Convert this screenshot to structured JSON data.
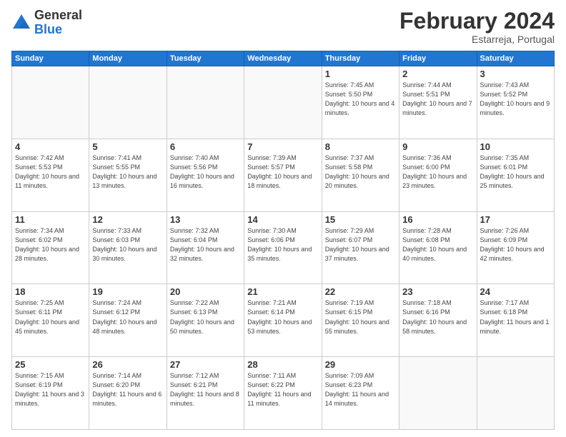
{
  "header": {
    "logo_general": "General",
    "logo_blue": "Blue",
    "title": "February 2024",
    "subtitle": "Estarreja, Portugal"
  },
  "weekdays": [
    "Sunday",
    "Monday",
    "Tuesday",
    "Wednesday",
    "Thursday",
    "Friday",
    "Saturday"
  ],
  "weeks": [
    [
      {
        "day": "",
        "info": ""
      },
      {
        "day": "",
        "info": ""
      },
      {
        "day": "",
        "info": ""
      },
      {
        "day": "",
        "info": ""
      },
      {
        "day": "1",
        "info": "Sunrise: 7:45 AM\nSunset: 5:50 PM\nDaylight: 10 hours\nand 4 minutes."
      },
      {
        "day": "2",
        "info": "Sunrise: 7:44 AM\nSunset: 5:51 PM\nDaylight: 10 hours\nand 7 minutes."
      },
      {
        "day": "3",
        "info": "Sunrise: 7:43 AM\nSunset: 5:52 PM\nDaylight: 10 hours\nand 9 minutes."
      }
    ],
    [
      {
        "day": "4",
        "info": "Sunrise: 7:42 AM\nSunset: 5:53 PM\nDaylight: 10 hours\nand 11 minutes."
      },
      {
        "day": "5",
        "info": "Sunrise: 7:41 AM\nSunset: 5:55 PM\nDaylight: 10 hours\nand 13 minutes."
      },
      {
        "day": "6",
        "info": "Sunrise: 7:40 AM\nSunset: 5:56 PM\nDaylight: 10 hours\nand 16 minutes."
      },
      {
        "day": "7",
        "info": "Sunrise: 7:39 AM\nSunset: 5:57 PM\nDaylight: 10 hours\nand 18 minutes."
      },
      {
        "day": "8",
        "info": "Sunrise: 7:37 AM\nSunset: 5:58 PM\nDaylight: 10 hours\nand 20 minutes."
      },
      {
        "day": "9",
        "info": "Sunrise: 7:36 AM\nSunset: 6:00 PM\nDaylight: 10 hours\nand 23 minutes."
      },
      {
        "day": "10",
        "info": "Sunrise: 7:35 AM\nSunset: 6:01 PM\nDaylight: 10 hours\nand 25 minutes."
      }
    ],
    [
      {
        "day": "11",
        "info": "Sunrise: 7:34 AM\nSunset: 6:02 PM\nDaylight: 10 hours\nand 28 minutes."
      },
      {
        "day": "12",
        "info": "Sunrise: 7:33 AM\nSunset: 6:03 PM\nDaylight: 10 hours\nand 30 minutes."
      },
      {
        "day": "13",
        "info": "Sunrise: 7:32 AM\nSunset: 6:04 PM\nDaylight: 10 hours\nand 32 minutes."
      },
      {
        "day": "14",
        "info": "Sunrise: 7:30 AM\nSunset: 6:06 PM\nDaylight: 10 hours\nand 35 minutes."
      },
      {
        "day": "15",
        "info": "Sunrise: 7:29 AM\nSunset: 6:07 PM\nDaylight: 10 hours\nand 37 minutes."
      },
      {
        "day": "16",
        "info": "Sunrise: 7:28 AM\nSunset: 6:08 PM\nDaylight: 10 hours\nand 40 minutes."
      },
      {
        "day": "17",
        "info": "Sunrise: 7:26 AM\nSunset: 6:09 PM\nDaylight: 10 hours\nand 42 minutes."
      }
    ],
    [
      {
        "day": "18",
        "info": "Sunrise: 7:25 AM\nSunset: 6:11 PM\nDaylight: 10 hours\nand 45 minutes."
      },
      {
        "day": "19",
        "info": "Sunrise: 7:24 AM\nSunset: 6:12 PM\nDaylight: 10 hours\nand 48 minutes."
      },
      {
        "day": "20",
        "info": "Sunrise: 7:22 AM\nSunset: 6:13 PM\nDaylight: 10 hours\nand 50 minutes."
      },
      {
        "day": "21",
        "info": "Sunrise: 7:21 AM\nSunset: 6:14 PM\nDaylight: 10 hours\nand 53 minutes."
      },
      {
        "day": "22",
        "info": "Sunrise: 7:19 AM\nSunset: 6:15 PM\nDaylight: 10 hours\nand 55 minutes."
      },
      {
        "day": "23",
        "info": "Sunrise: 7:18 AM\nSunset: 6:16 PM\nDaylight: 10 hours\nand 58 minutes."
      },
      {
        "day": "24",
        "info": "Sunrise: 7:17 AM\nSunset: 6:18 PM\nDaylight: 11 hours\nand 1 minute."
      }
    ],
    [
      {
        "day": "25",
        "info": "Sunrise: 7:15 AM\nSunset: 6:19 PM\nDaylight: 11 hours\nand 3 minutes."
      },
      {
        "day": "26",
        "info": "Sunrise: 7:14 AM\nSunset: 6:20 PM\nDaylight: 11 hours\nand 6 minutes."
      },
      {
        "day": "27",
        "info": "Sunrise: 7:12 AM\nSunset: 6:21 PM\nDaylight: 11 hours\nand 8 minutes."
      },
      {
        "day": "28",
        "info": "Sunrise: 7:11 AM\nSunset: 6:22 PM\nDaylight: 11 hours\nand 11 minutes."
      },
      {
        "day": "29",
        "info": "Sunrise: 7:09 AM\nSunset: 6:23 PM\nDaylight: 11 hours\nand 14 minutes."
      },
      {
        "day": "",
        "info": ""
      },
      {
        "day": "",
        "info": ""
      }
    ]
  ]
}
